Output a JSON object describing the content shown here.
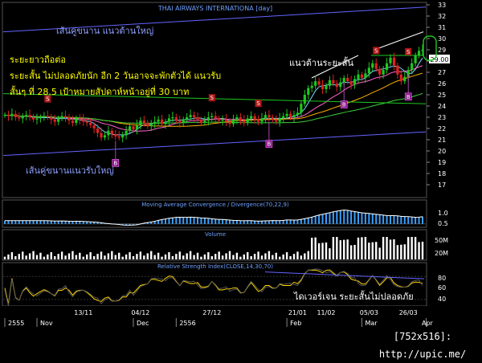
{
  "chart_data": {
    "type": "candlestick",
    "title": "THAI AIRWAYS INTERNATIONA [day]",
    "price_axis": {
      "ylim": [
        16,
        33
      ],
      "ticks": [
        17,
        18,
        19,
        20,
        21,
        22,
        23,
        24,
        25,
        26,
        27,
        28,
        29,
        30,
        31,
        32,
        33
      ]
    },
    "last_price": "29.00",
    "x_date_labels": [
      "13/11",
      "04/12",
      "27/12",
      "21/01",
      "11/02",
      "05/03",
      "26/03"
    ],
    "x_month_labels": [
      "2555",
      "Nov",
      "Dec",
      "2556",
      "Feb",
      "Mar",
      "Apr"
    ],
    "closes": [
      23.2,
      23.1,
      23.3,
      23.0,
      22.9,
      23.1,
      23.2,
      23.0,
      22.8,
      22.9,
      23.0,
      23.1,
      23.0,
      22.8,
      22.6,
      22.9,
      23.1,
      23.0,
      22.7,
      22.5,
      22.9,
      22.8,
      22.6,
      22.5,
      22.3,
      22.0,
      21.6,
      21.2,
      21.4,
      21.8,
      21.5,
      21.3,
      21.2,
      21.4,
      21.8,
      22.2,
      21.9,
      22.3,
      22.7,
      22.5,
      22.2,
      22.4,
      22.6,
      22.8,
      22.4,
      22.6,
      22.9,
      23.0,
      22.7,
      22.5,
      22.8,
      23.0,
      23.2,
      23.0,
      22.8,
      22.5,
      22.7,
      23.0,
      23.1,
      22.9,
      22.7,
      22.8,
      22.6,
      22.4,
      22.8,
      23.0,
      22.7,
      22.5,
      22.9,
      23.1,
      22.8,
      22.6,
      22.9,
      23.2,
      23.0,
      22.8,
      22.6,
      22.9,
      23.1,
      23.3,
      23.0,
      23.2,
      23.4,
      24.2,
      25.0,
      25.6,
      25.8,
      26.2,
      25.9,
      25.5,
      25.8,
      26.3,
      26.0,
      25.7,
      26.1,
      26.5,
      26.2,
      25.9,
      26.4,
      26.8,
      26.5,
      26.9,
      27.4,
      27.8,
      27.3,
      26.8,
      27.2,
      27.8,
      28.3,
      27.6,
      26.8,
      26.2,
      26.6,
      27.2,
      27.8,
      28.5,
      28.9,
      29.0
    ],
    "buy_signals": [
      31,
      74,
      95,
      113
    ],
    "sell_signals": [
      12,
      58,
      71,
      104,
      113
    ],
    "panels": [
      {
        "name": "Moving Average Convergence / Divergence(70,22,9)",
        "ylim": [
          -0.2,
          1.3
        ],
        "ticks": [
          "1.0",
          "0.5"
        ]
      },
      {
        "name": "Volume",
        "ticks": [
          "50M",
          "20M"
        ]
      },
      {
        "name": "Relative Strength Index(CLOSE,14,30,70)",
        "ylim": [
          20,
          90
        ],
        "ticks": [
          "80",
          "60",
          "40"
        ]
      }
    ]
  },
  "annotations": {
    "long_support": "เส้นคู่ขนาน แนวต้านใหญ่",
    "long_trend": "ระยะยาวถือต่อ",
    "short_term": "ระยะสั้น ไม่ปลอดภัยนัก อีก 2 วันอาจจะพักตัวได้  แนวรับ",
    "short_support": "สั้นๆ ที่ 28.5 เป้าหมายสัปดาห์หน้าอยู่ที่ 30 บาท",
    "short_resistance": "แนวต้านระยะสั้น",
    "channel_bottom": "เส้นคู่ขนานแนวรับใหญ่",
    "rsi_divergence": "ไดเวอร์เจน ระยะสั้นไม่ปลอดภัย"
  },
  "colors": {
    "up": "#1ec81e",
    "down": "#e02020",
    "bg": "#000000",
    "axis_text": "#ffffff",
    "channel": "#6464ff",
    "annotation": "#ffff00",
    "annotation_white": "#ffffff",
    "signal_sell": "#b01818",
    "signal_buy": "#8a1a8a"
  },
  "footer": "[752x516]: http://upic.me/"
}
